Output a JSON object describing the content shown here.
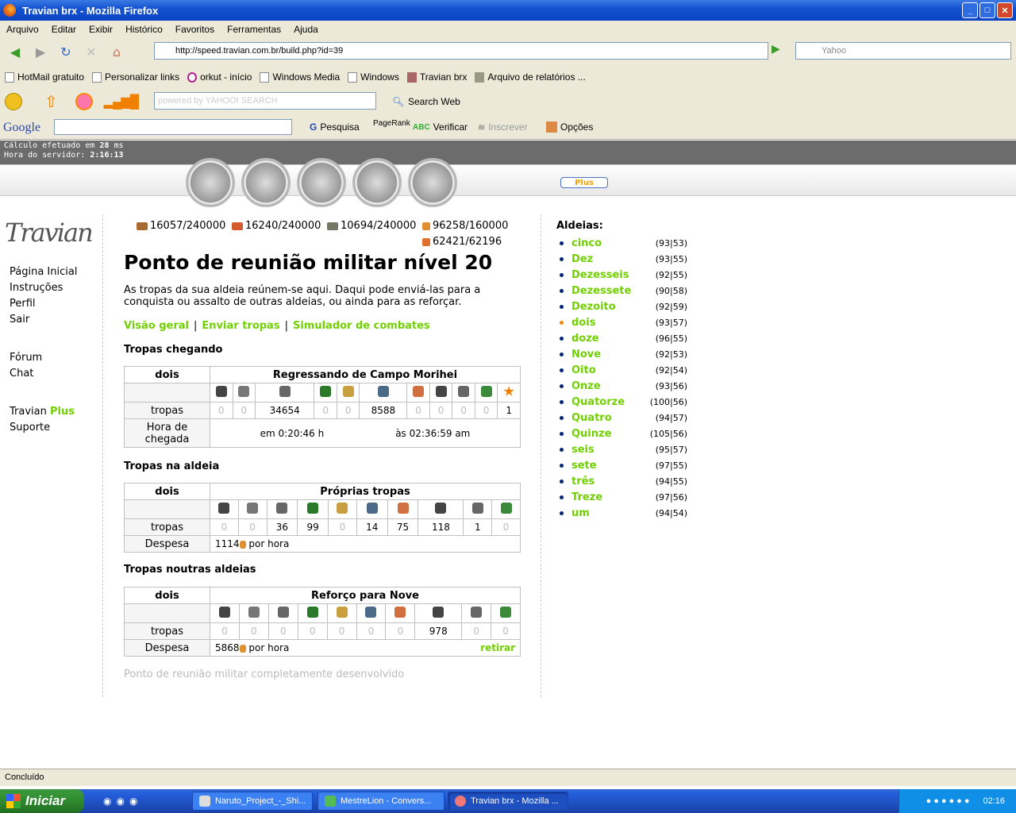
{
  "window": {
    "title": "Travian brx - Mozilla Firefox",
    "min": "_",
    "max": "□",
    "close": "✕"
  },
  "menu": [
    "Arquivo",
    "Editar",
    "Exibir",
    "Histórico",
    "Favoritos",
    "Ferramentas",
    "Ajuda"
  ],
  "nav": {
    "url": "http://speed.travian.com.br/build.php?id=39",
    "search_placeholder": "Yahoo"
  },
  "bookmarks": [
    "HotMail gratuito",
    "Personalizar links",
    "orkut - início",
    "Windows Media",
    "Windows",
    "Travian brx",
    "Arquivo de relatórios ..."
  ],
  "yahoo": {
    "placeholder": "powered by YAHOO! SEARCH",
    "search_web": "Search Web"
  },
  "google": {
    "logo": "Google",
    "pesquisa": "Pesquisa",
    "pagerank": "PageRank",
    "verificar": "Verificar",
    "inscrever": "Inscrever",
    "opcoes": "Opções"
  },
  "server": {
    "calc_label": "Cálculo efetuado em",
    "calc_value": "28",
    "calc_unit": "ms",
    "time_label": "Hora do servidor:",
    "time_value": "2:16:13"
  },
  "plus_button": "Plus",
  "sidebar": {
    "logo": "Travian",
    "links": [
      "Página Inicial",
      "Instruções",
      "Perfil",
      "Sair",
      "Fórum",
      "Chat"
    ],
    "travian": "Travian",
    "plus": "Plus",
    "suporte": "Suporte"
  },
  "resources": {
    "wood": "16057/240000",
    "clay": "16240/240000",
    "iron": "10694/240000",
    "crop": "96258/160000",
    "consumption": "62421/62196"
  },
  "colors": {
    "accent": "#71d000",
    "link_dot": "#00257a",
    "current_dot": "#f28b00"
  },
  "page": {
    "title": "Ponto de reunião militar nível 20",
    "desc": "As tropas da sua aldeia reúnem-se aqui. Daqui pode enviá-las para a conquista ou assalto de outras aldeias, ou ainda para as reforçar.",
    "links": [
      "Visão geral",
      "Enviar tropas",
      "Simulador de combates"
    ],
    "sect1": "Tropas chegando",
    "sect2": "Tropas na aldeia",
    "sect3": "Tropas noutras aldeias",
    "footnote": "Ponto de reunião militar completamente desenvolvido"
  },
  "table1": {
    "village": "dois",
    "header": "Regressando de Campo Morihei",
    "row_label": "tropas",
    "values": [
      "0",
      "0",
      "34654",
      "0",
      "0",
      "8588",
      "0",
      "0",
      "0",
      "0",
      "1"
    ],
    "arrival_label": "Hora de chegada",
    "in": "em 0:20:46 h",
    "at": "às 02:36:59 am"
  },
  "table2": {
    "village": "dois",
    "header": "Próprias tropas",
    "row_label": "tropas",
    "values": [
      "0",
      "0",
      "36",
      "99",
      "0",
      "14",
      "75",
      "118",
      "1",
      "0"
    ],
    "upkeep_label": "Despesa",
    "upkeep_value": "1114",
    "upkeep_unit": "por hora"
  },
  "table3": {
    "village": "dois",
    "header": "Reforço para Nove",
    "row_label": "tropas",
    "values": [
      "0",
      "0",
      "0",
      "0",
      "0",
      "0",
      "0",
      "978",
      "0",
      "0"
    ],
    "upkeep_label": "Despesa",
    "upkeep_value": "5868",
    "upkeep_unit": "por hora",
    "withdraw": "retirar"
  },
  "villages_title": "Aldeias:",
  "villages": [
    {
      "name": "cinco",
      "coord": "(93|53)"
    },
    {
      "name": "Dez",
      "coord": "(93|55)"
    },
    {
      "name": "Dezesseis",
      "coord": "(92|55)"
    },
    {
      "name": "Dezessete",
      "coord": "(90|58)"
    },
    {
      "name": "Dezoito",
      "coord": "(92|59)"
    },
    {
      "name": "dois",
      "coord": "(93|57)",
      "current": true
    },
    {
      "name": "doze",
      "coord": "(96|55)"
    },
    {
      "name": "Nove",
      "coord": "(92|53)"
    },
    {
      "name": "Oito",
      "coord": "(92|54)"
    },
    {
      "name": "Onze",
      "coord": "(93|56)"
    },
    {
      "name": "Quatorze",
      "coord": "(100|56)"
    },
    {
      "name": "Quatro",
      "coord": "(94|57)"
    },
    {
      "name": "Quinze",
      "coord": "(105|56)"
    },
    {
      "name": "seis",
      "coord": "(95|57)"
    },
    {
      "name": "sete",
      "coord": "(97|55)"
    },
    {
      "name": "três",
      "coord": "(94|55)"
    },
    {
      "name": "Treze",
      "coord": "(97|56)"
    },
    {
      "name": "um",
      "coord": "(94|54)"
    }
  ],
  "status": "Concluído",
  "taskbar": {
    "start": "Iniciar",
    "tasks": [
      "Naruto_Project_-_Shi...",
      "MestreLion - Convers...",
      "Travian brx - Mozilla ..."
    ],
    "clock": "02:16"
  }
}
